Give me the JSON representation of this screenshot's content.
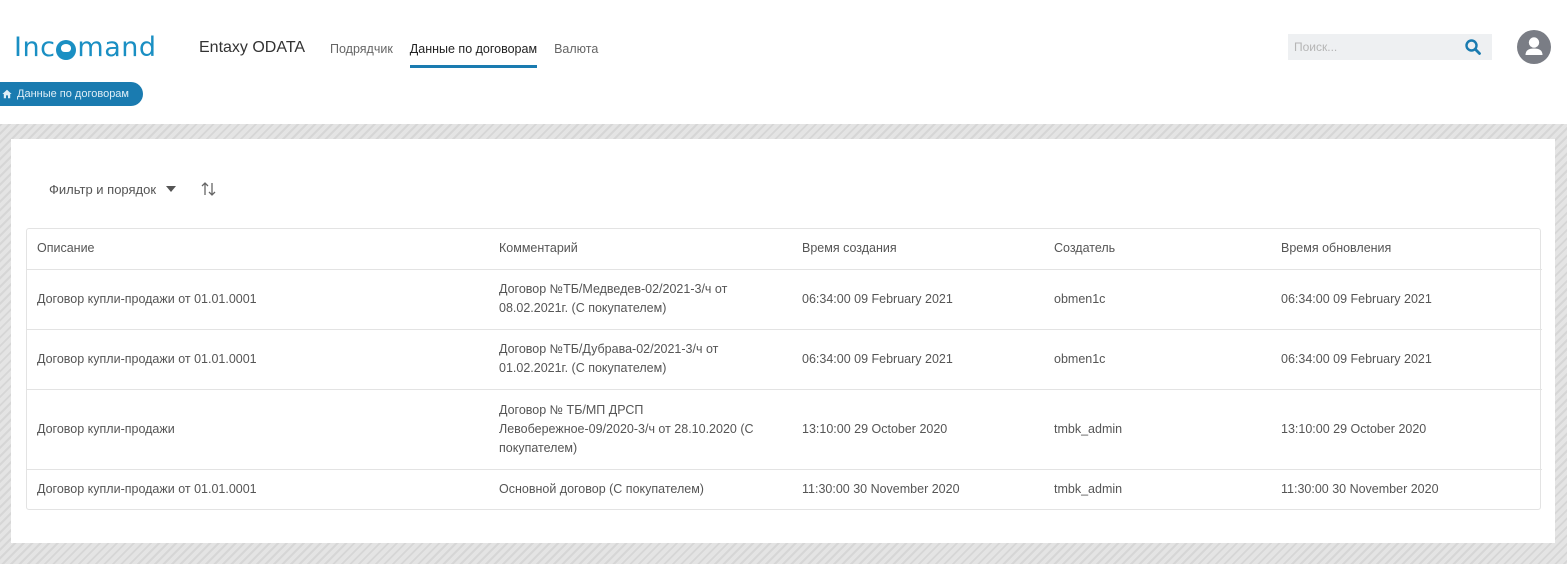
{
  "header": {
    "logo_left": "Inc",
    "logo_right": "mand",
    "app_name": "Entaxy ODATA",
    "nav": [
      {
        "label": "Подрядчик",
        "active": false
      },
      {
        "label": "Данные по договорам",
        "active": true
      },
      {
        "label": "Валюта",
        "active": false
      }
    ],
    "search_placeholder": "Поиск...",
    "search_icon": "search-icon",
    "avatar_icon": "user-icon"
  },
  "breadcrumb": {
    "icon": "home-icon",
    "label": "Данные по договорам"
  },
  "toolbar": {
    "filter_label": "Фильтр и порядок",
    "sort_icon": "sort-icon"
  },
  "table": {
    "columns": [
      "Описание",
      "Комментарий",
      "Время создания",
      "Создатель",
      "Время обновления"
    ],
    "rows": [
      [
        "Договор купли-продажи от 01.01.0001",
        "Договор №ТБ/Медведев-02/2021-3/ч от 08.02.2021г. (С покупателем)",
        "06:34:00 09 February 2021",
        "obmen1c",
        "06:34:00 09 February 2021"
      ],
      [
        "Договор купли-продажи от 01.01.0001",
        "Договор №ТБ/Дубрава-02/2021-3/ч от 01.02.2021г. (С покупателем)",
        "06:34:00 09 February 2021",
        "obmen1c",
        "06:34:00 09 February 2021"
      ],
      [
        "Договор купли-продажи",
        "Договор № ТБ/МП ДРСП Левобережное-09/2020-3/ч от 28.10.2020 (С покупателем)",
        "13:10:00 29 October 2020",
        "tmbk_admin",
        "13:10:00 29 October 2020"
      ],
      [
        "Договор купли-продажи от 01.01.0001",
        "Основной договор (С покупателем)",
        "11:30:00 30 November 2020",
        "tmbk_admin",
        "11:30:00 30 November 2020"
      ]
    ]
  },
  "colors": {
    "accent": "#1a7bb0",
    "logo": "#1a8fc3"
  }
}
